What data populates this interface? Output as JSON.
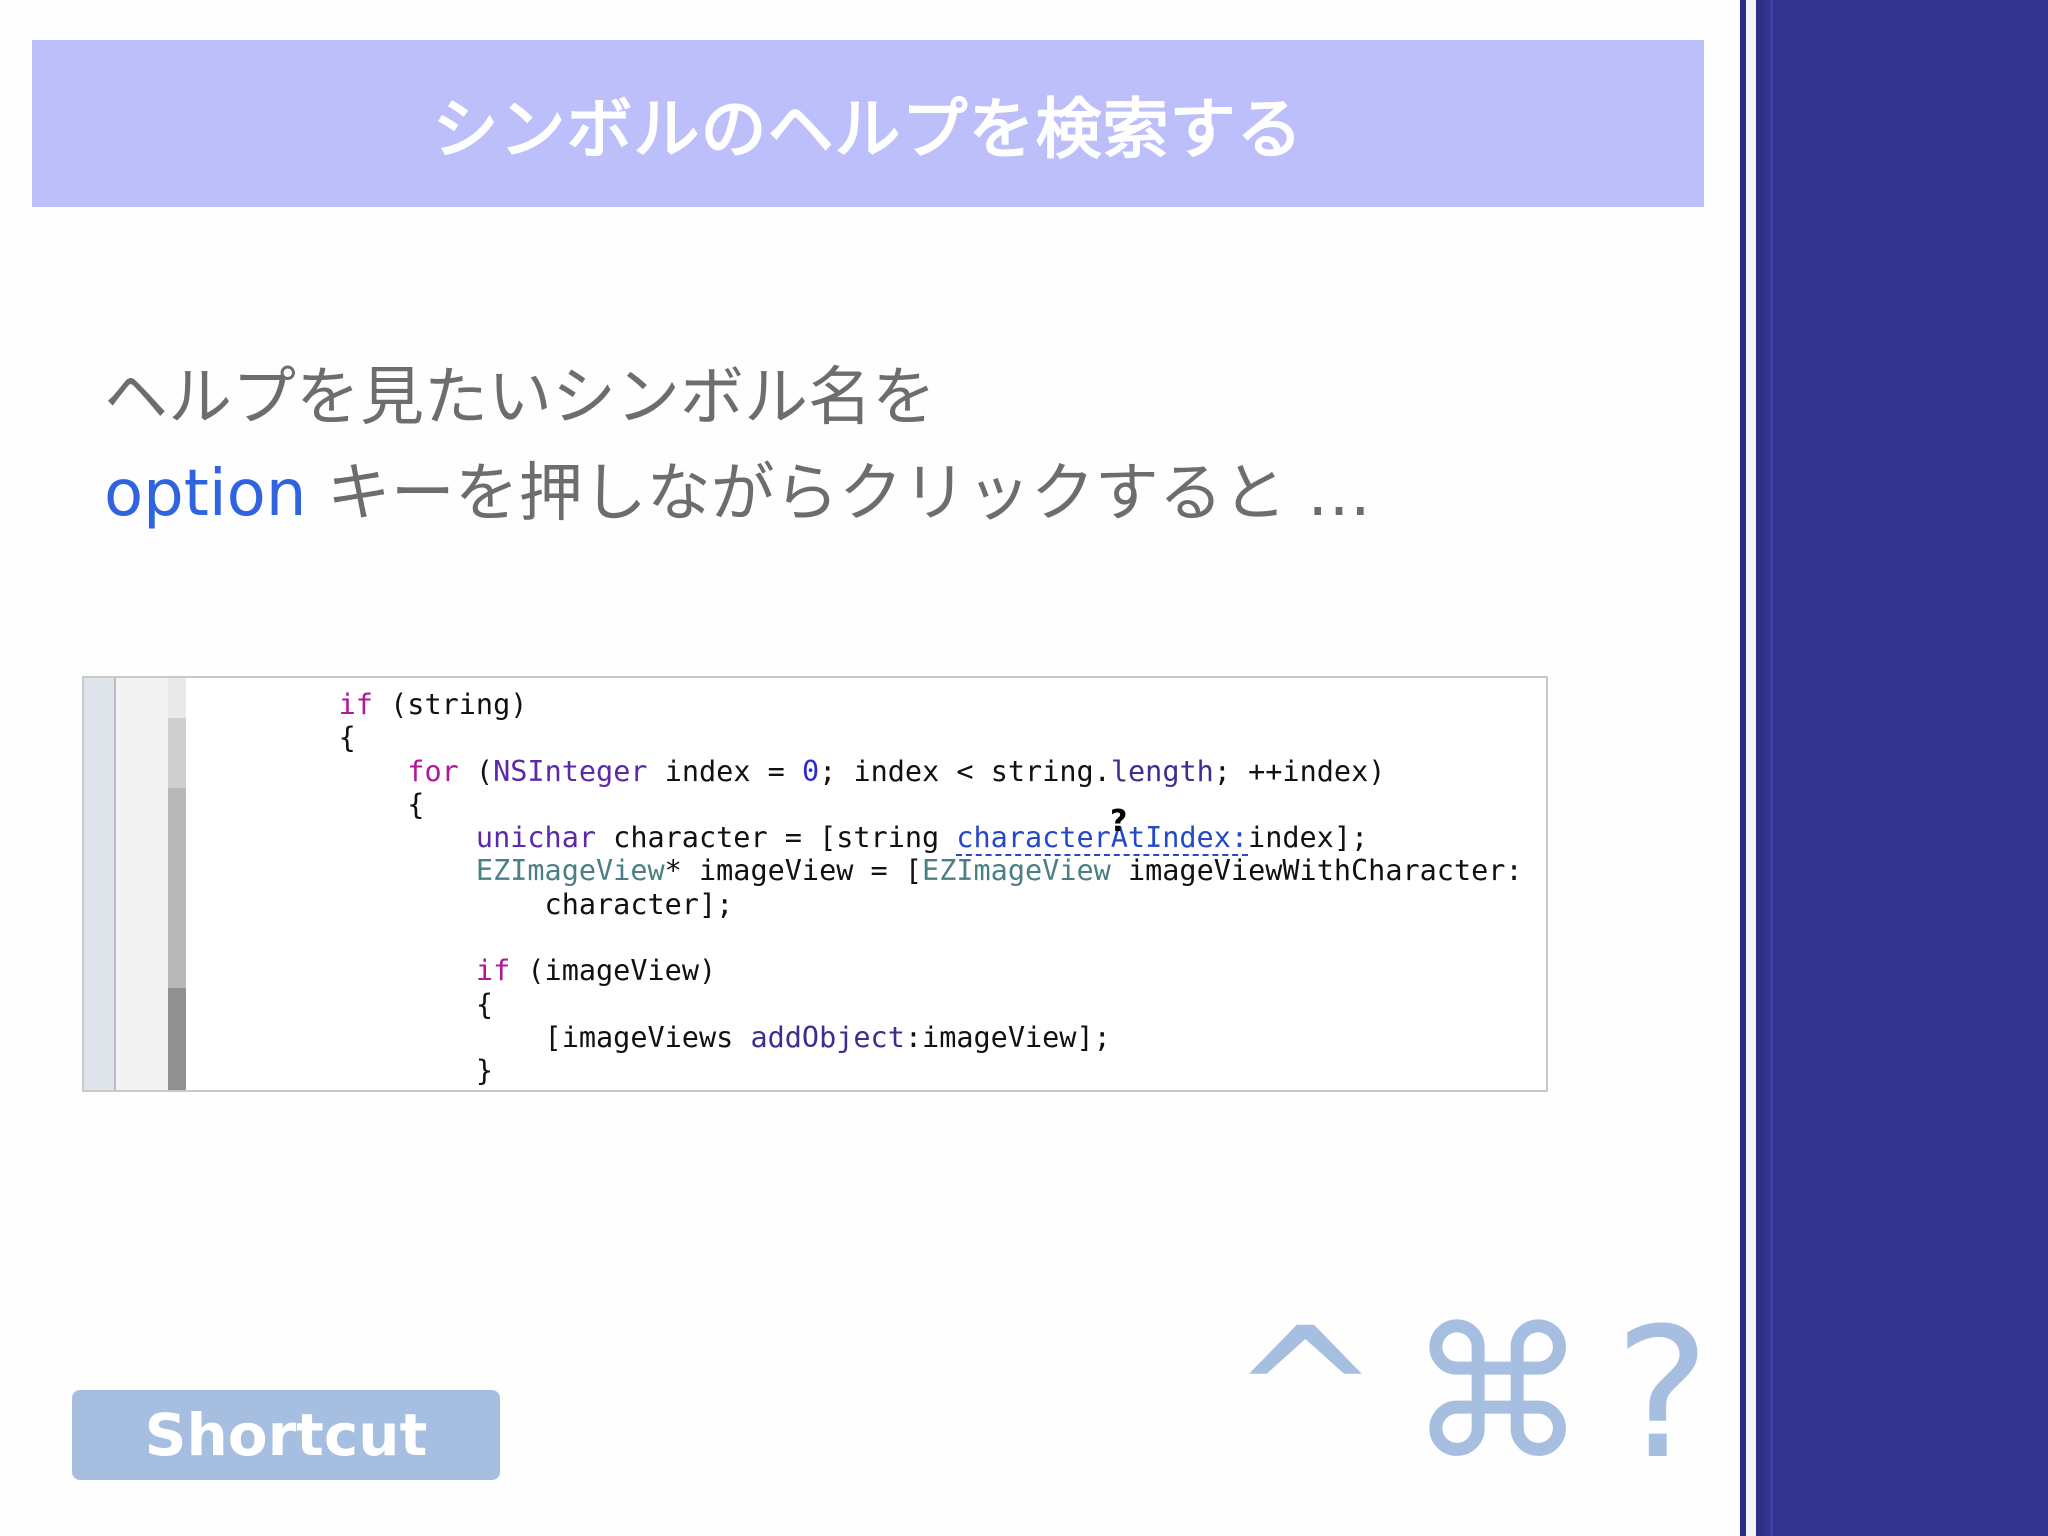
{
  "slide": {
    "title": "シンボルのヘルプを検索する",
    "body": {
      "line1": "ヘルプを見たいシンボル名を",
      "line2_keyword": "option",
      "line2_rest": " キーを押しながらクリックすると …"
    },
    "code": {
      "lines": [
        [
          "    ",
          {
            "t": "if",
            "c": "kw"
          },
          " (string)"
        ],
        [
          "    {"
        ],
        [
          "        ",
          {
            "t": "for",
            "c": "kw"
          },
          " (",
          {
            "t": "NSInteger",
            "c": "type"
          },
          " index = ",
          {
            "t": "0",
            "c": "num"
          },
          "; index < string.",
          {
            "t": "length",
            "c": "meth"
          },
          "; ++index)"
        ],
        [
          "        {"
        ],
        [
          "            ",
          {
            "t": "unichar",
            "c": "type"
          },
          " character = [string ",
          {
            "t": "characterAtIndex:",
            "c": "link"
          },
          "index];"
        ],
        [
          "            ",
          {
            "t": "EZImageView",
            "c": "class"
          },
          "* imageView = [",
          {
            "t": "EZImageView",
            "c": "class"
          },
          " imageViewWithCharacter:"
        ],
        [
          "                character];"
        ],
        [
          ""
        ],
        [
          "            ",
          {
            "t": "if",
            "c": "kw"
          },
          " (imageView)"
        ],
        [
          "            {"
        ],
        [
          "                [imageViews ",
          {
            "t": "addObject",
            "c": "meth"
          },
          ":imageView];"
        ],
        [
          "            }"
        ]
      ],
      "cursor_glyph": "?"
    },
    "shortcut_label": "Shortcut",
    "shortcut_keys": [
      "^",
      "⌘",
      "?"
    ]
  },
  "colors": {
    "title_bar": "#bcbffa",
    "sidebar": "#34348f",
    "keyword_blue": "#2f63e0",
    "shortcut": "#a6bee0"
  }
}
